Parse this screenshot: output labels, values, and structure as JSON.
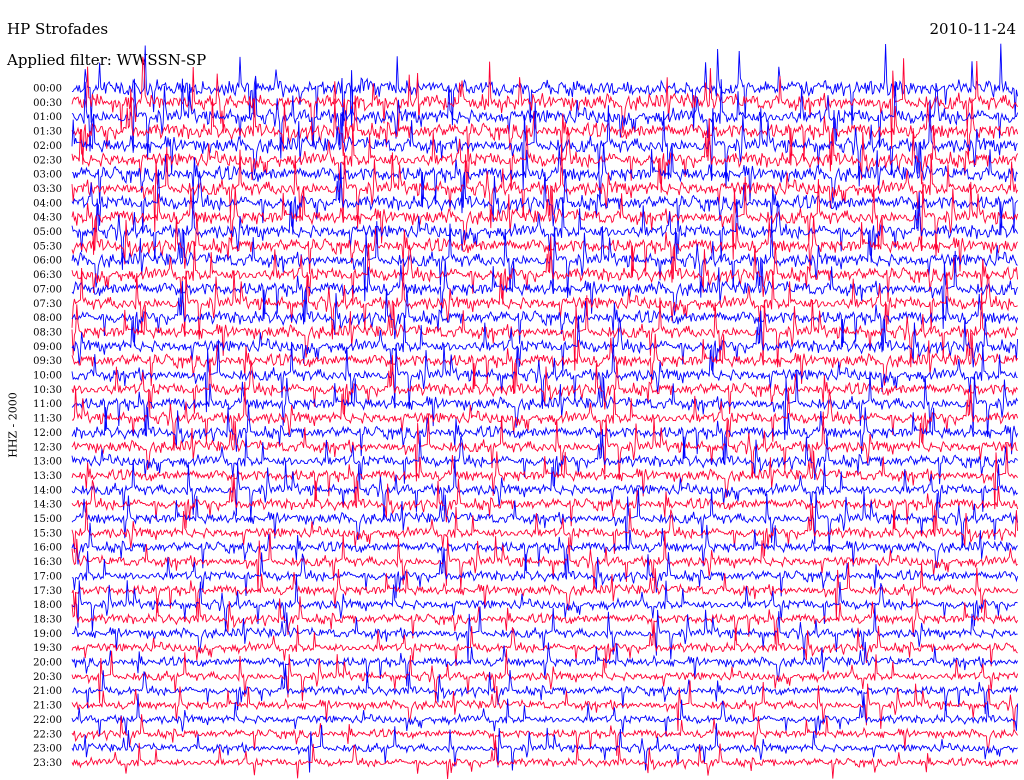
{
  "header": {
    "station": "HP Strofades",
    "filter_label": "Applied filter:",
    "filter_value": "WWSSN-SP",
    "date": "2010-11-24"
  },
  "chart_data": {
    "type": "line",
    "title": "HP Strofades",
    "date": "2010-11-24",
    "filter": "WWSSN-SP",
    "ylabel": "HHZ - 2000",
    "trace_colors": [
      "#0000ff",
      "#ff0033"
    ],
    "row_labels": [
      "00:00",
      "00:30",
      "01:00",
      "01:30",
      "02:00",
      "02:30",
      "03:00",
      "03:30",
      "04:00",
      "04:30",
      "05:00",
      "05:30",
      "06:00",
      "06:30",
      "07:00",
      "07:30",
      "08:00",
      "08:30",
      "09:00",
      "09:30",
      "10:00",
      "10:30",
      "11:00",
      "11:30",
      "12:00",
      "12:30",
      "13:00",
      "13:30",
      "14:00",
      "14:30",
      "15:00",
      "15:30",
      "16:00",
      "16:30",
      "17:00",
      "17:30",
      "18:00",
      "18:30",
      "19:00",
      "19:30",
      "20:00",
      "20:30",
      "21:00",
      "21:30",
      "22:00",
      "22:30",
      "23:00",
      "23:30"
    ]
  }
}
